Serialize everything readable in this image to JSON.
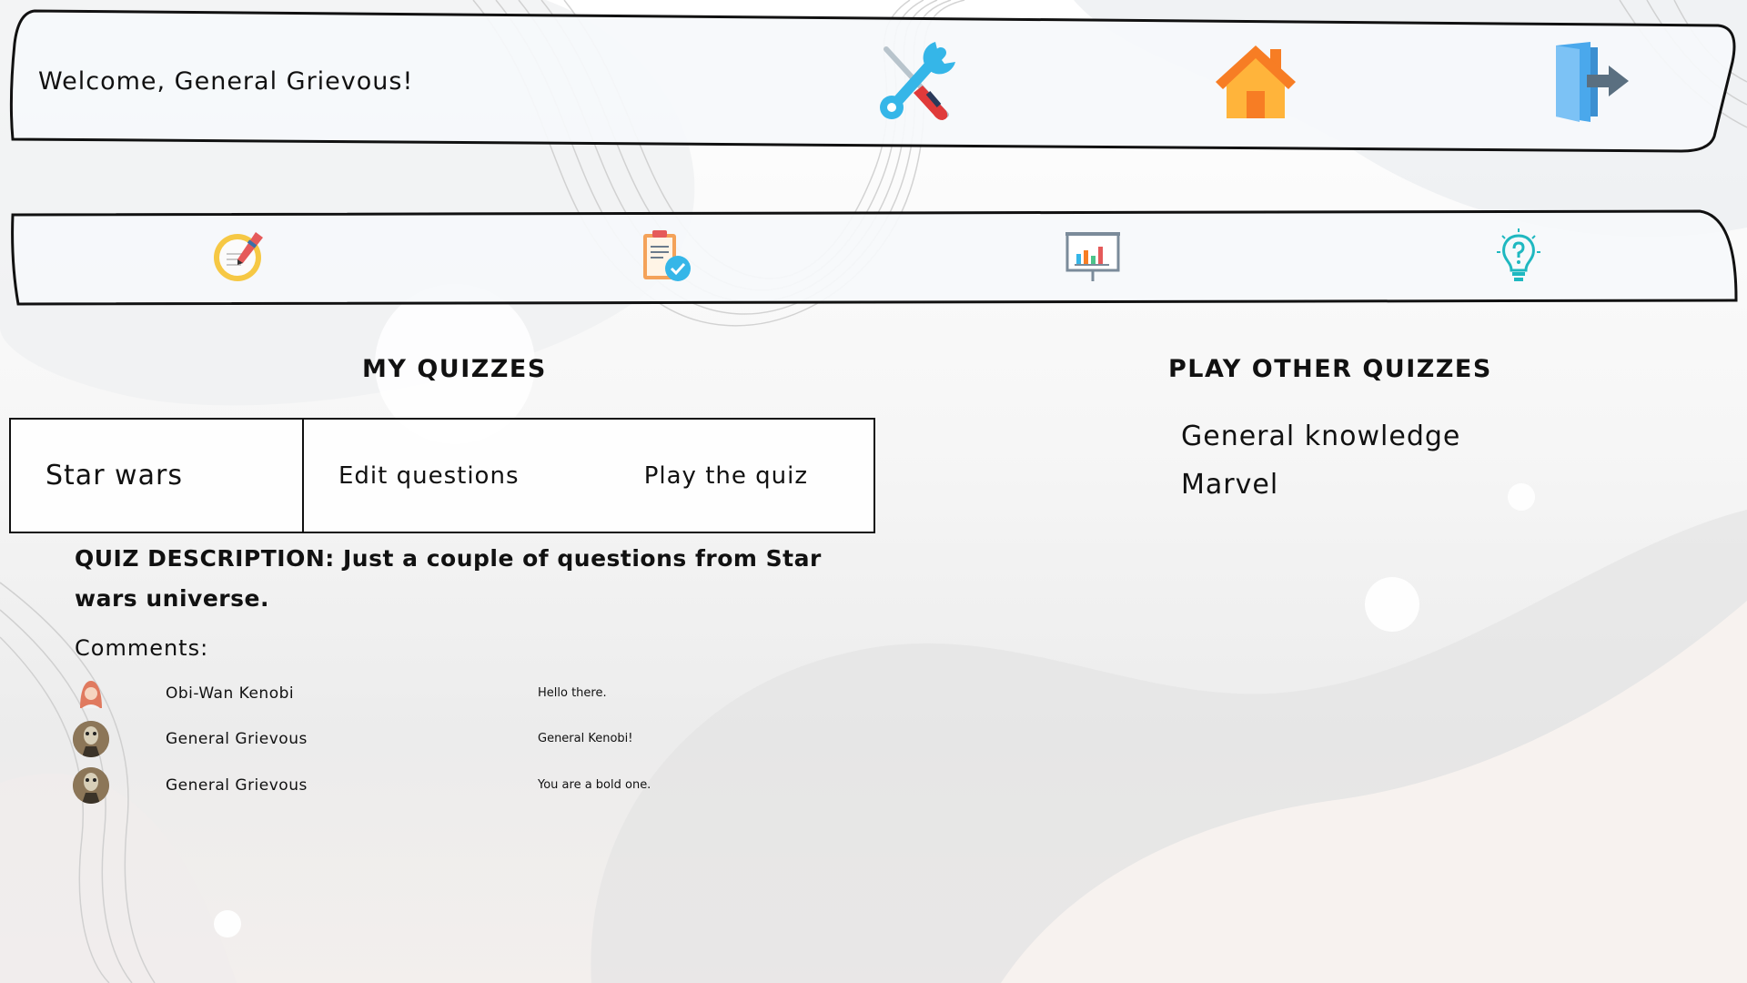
{
  "header": {
    "welcome": "Welcome, General Grievous!",
    "icons": [
      "tools-icon",
      "home-icon",
      "logout-icon"
    ]
  },
  "nav": {
    "icons": [
      "create-quiz-icon",
      "quiz-list-icon",
      "statistics-icon",
      "idea-icon"
    ]
  },
  "my_quizzes": {
    "title": "MY QUIZZES",
    "quiz_name": "Star wars",
    "edit_label": "Edit questions",
    "play_label": "Play the quiz",
    "description_label": "QUIZ DESCRIPTION:",
    "description_text": "Just a couple of questions from Star wars universe."
  },
  "comments": {
    "label": "Comments:",
    "items": [
      {
        "author": "Obi-Wan Kenobi",
        "text": "Hello there.",
        "avatar": "obi-wan-avatar"
      },
      {
        "author": "General Grievous",
        "text": "General Kenobi!",
        "avatar": "grievous-avatar"
      },
      {
        "author": "General Grievous",
        "text": "You are a bold one.",
        "avatar": "grievous-avatar"
      }
    ]
  },
  "other_quizzes": {
    "title": "PLAY OTHER QUIZZES",
    "items": [
      "General knowledge",
      "Marvel"
    ]
  },
  "colors": {
    "home_orange": "#f77d24",
    "door_blue": "#4aa8ec",
    "tool_cyan": "#35b6e8",
    "bulb_teal": "#1fb8c0"
  }
}
